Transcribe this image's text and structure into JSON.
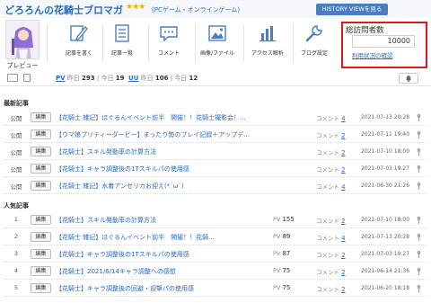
{
  "header": {
    "blog_title": "どろろんの花騎士ブロマガ",
    "stars": "★★★",
    "category": "(PCゲーム・オンラインゲーム)",
    "history_view_button": "HISTORY VIEWを見る"
  },
  "toolbar": {
    "preview_label": "プレビュー",
    "items": [
      {
        "label": "記事を書く",
        "icon": "pen-icon"
      },
      {
        "label": "記事一覧",
        "icon": "article-list-icon"
      },
      {
        "label": "コメント",
        "icon": "comment-icon"
      },
      {
        "label": "画像/ファイル",
        "icon": "image-icon"
      },
      {
        "label": "アクセス解析",
        "icon": "bar-chart-icon"
      },
      {
        "label": "ブログ設定",
        "icon": "wrench-icon"
      }
    ]
  },
  "visits": {
    "title": "総訪問者数",
    "count": "10000",
    "link": "利用状況の確認"
  },
  "stats": {
    "pv_label": "PV",
    "uu_label": "UU",
    "yesterday_label": "昨日",
    "today_label": "今日",
    "pv_yesterday": "293",
    "pv_today": "19",
    "uu_yesterday": "106",
    "uu_today": "12"
  },
  "recent": {
    "heading": "最新記事",
    "edit_label": "編集",
    "comment_label": "コメント",
    "rows": [
      {
        "status": "公開",
        "title": "【花騎士 雑記】ほぐるんイベント前半　開催！！花騎士撮影会！...",
        "comments": "4",
        "date": "2021-07-13 20:28"
      },
      {
        "status": "公開",
        "title": "【ウマ娘プリティーダービー】まったり勢のプレイ記録＋アップデ...",
        "comments": "2",
        "date": "2021-07-11 19:40"
      },
      {
        "status": "公開",
        "title": "【花騎士】スキル発動率の計算方法",
        "comments": "2",
        "date": "2021-07-10 18:00"
      },
      {
        "status": "公開",
        "title": "【花騎士】キャラ調整後の1Tスキルパの使用感",
        "comments": "2",
        "date": "2021-07-03 19:27"
      },
      {
        "status": "公開",
        "title": "【花騎士 雑記】水着アンゼリカお迎え(*´ω`)",
        "comments": "4",
        "date": "2021-06-30 21:26"
      }
    ]
  },
  "popular": {
    "heading": "人気記事",
    "edit_label": "編集",
    "pv_label": "PV",
    "comment_label": "コメント",
    "rows": [
      {
        "rank": "1",
        "title": "【花騎士】スキル発動率の計算方法",
        "pv": "155",
        "comments": "2",
        "date": "2021-07-10 18:00"
      },
      {
        "rank": "2",
        "title": "【花騎士 雑記】ほぐるんイベント前半　開催！！花騎...",
        "pv": "89",
        "comments": "4",
        "date": "2021-07-13 20:28"
      },
      {
        "rank": "3",
        "title": "【花騎士】キャラ調整後の1Tスキルパの使用感",
        "pv": "87",
        "comments": "2",
        "date": "2021-07-03 19:27"
      },
      {
        "rank": "4",
        "title": "【花騎士】2021/6/14キャラ調整への感想",
        "pv": "75",
        "comments": "2",
        "date": "2021-06-14 21:36"
      },
      {
        "rank": "5",
        "title": "【花騎士】キャラ調整後の回避・迎撃パの使用感",
        "pv": "75",
        "comments": "2",
        "date": "2021-06-20 18:18"
      }
    ]
  }
}
